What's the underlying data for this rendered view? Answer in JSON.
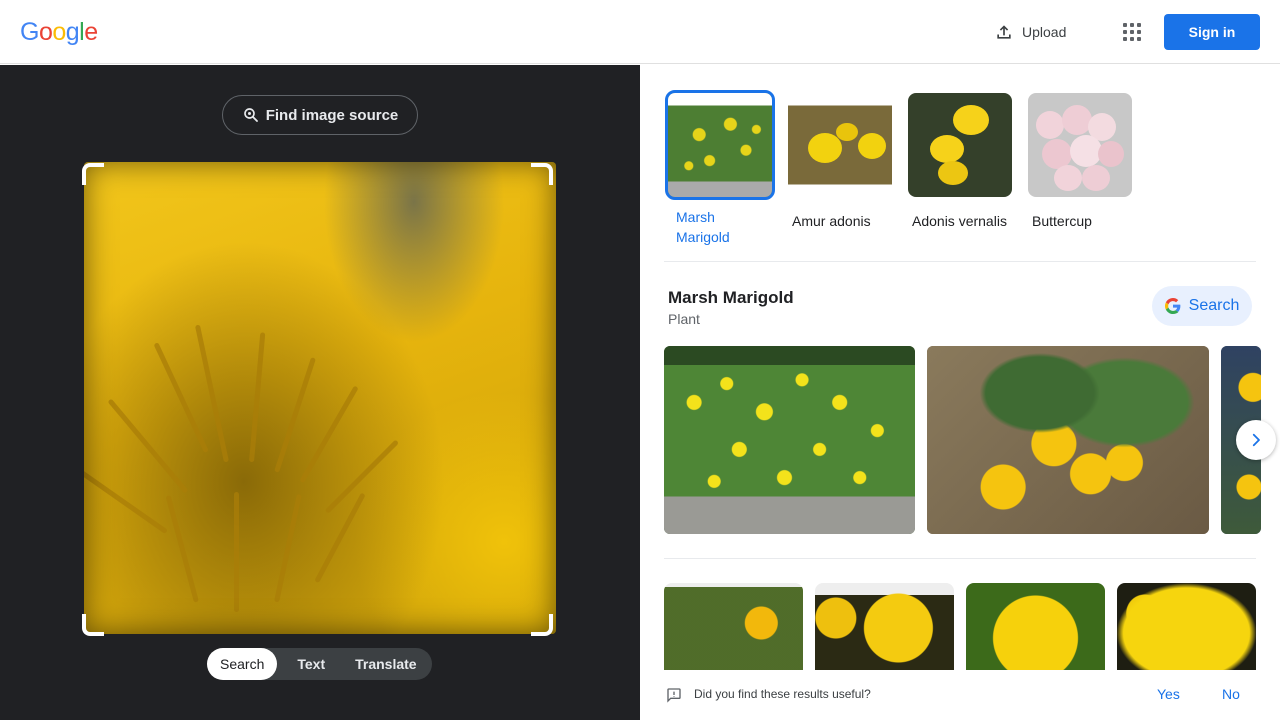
{
  "header": {
    "logo": [
      "G",
      "o",
      "o",
      "g",
      "l",
      "e"
    ],
    "logo_colors": [
      "#4285f4",
      "#ea4335",
      "#fbbc05",
      "#4285f4",
      "#34a853",
      "#ea4335"
    ],
    "upload_label": "Upload",
    "signin_label": "Sign in"
  },
  "left": {
    "find_source_label": "Find image source",
    "modes": [
      "Search",
      "Text",
      "Translate"
    ],
    "active_mode": "Search"
  },
  "related": [
    {
      "label": "Marsh Marigold",
      "selected": true
    },
    {
      "label": "Amur adonis",
      "selected": false
    },
    {
      "label": "Adonis vernalis",
      "selected": false
    },
    {
      "label": "Buttercup",
      "selected": false
    }
  ],
  "entity": {
    "title": "Marsh Marigold",
    "subtitle": "Plant",
    "search_label": "Search"
  },
  "feedback": {
    "question": "Did you find these results useful?",
    "yes": "Yes",
    "no": "No"
  },
  "colors": {
    "accent": "#1a73e8",
    "dark_bg": "#202124"
  }
}
